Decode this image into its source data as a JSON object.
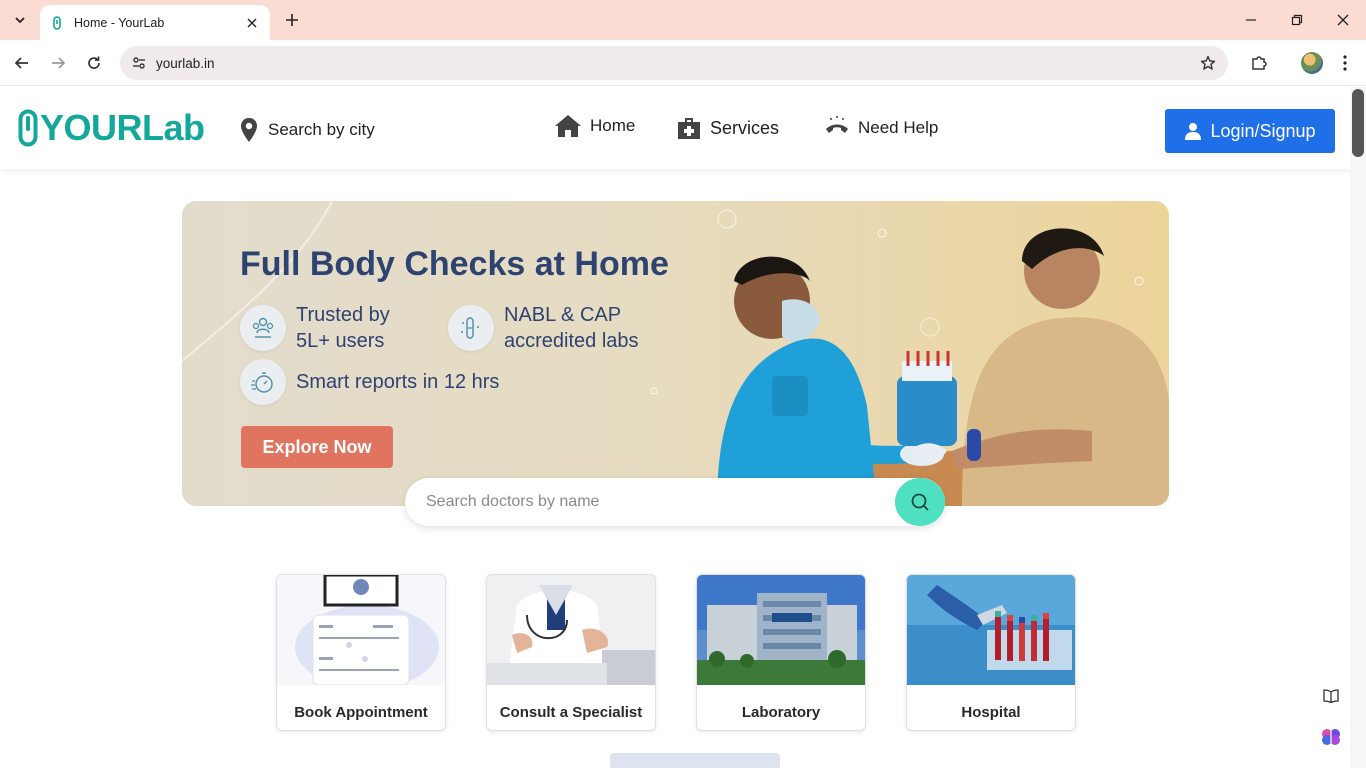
{
  "browser": {
    "tab_title": "Home - YourLab",
    "url": "yourlab.in"
  },
  "header": {
    "logo_text": "YOURLab",
    "city_search": "Search by city",
    "nav": [
      {
        "label": "Home",
        "icon": "home-icon"
      },
      {
        "label": "Services",
        "icon": "medical-kit-icon"
      },
      {
        "label": "Need Help",
        "icon": "phone-icon"
      }
    ],
    "login_label": "Login/Signup"
  },
  "banner": {
    "title": "Full Body Checks at Home",
    "features": [
      {
        "line1": "Trusted by",
        "line2": "5L+ users"
      },
      {
        "line1": "NABL & CAP",
        "line2": "accredited labs"
      },
      {
        "line1": "Smart reports in 12 hrs",
        "line2": ""
      }
    ],
    "cta": "Explore Now"
  },
  "search": {
    "placeholder": "Search doctors by name",
    "value": ""
  },
  "cards": [
    {
      "label": "Book Appointment"
    },
    {
      "label": "Consult a Specialist"
    },
    {
      "label": "Laboratory"
    },
    {
      "label": "Hospital"
    }
  ],
  "colors": {
    "brand": "#14a89c",
    "login_button": "#1e6fe8",
    "banner_title": "#2f4370",
    "cta": "#e0745e",
    "search_button": "#4ee0c0"
  }
}
